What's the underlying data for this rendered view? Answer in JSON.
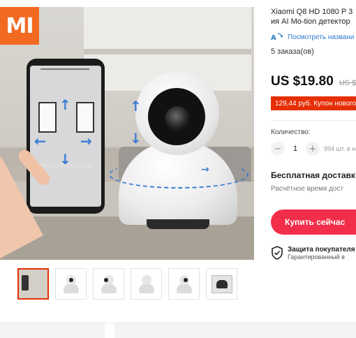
{
  "brand": {
    "logo_text": "MI",
    "logo_color": "#f26a21"
  },
  "product": {
    "title_line1": "Xiaomi Q8 HD 1080 P 3",
    "title_line2": "ия AI Mo-tion детектор",
    "translate_label": "Посмотреть названи",
    "translate_icon": "translate-icon",
    "orders": "5 заказа(ов)",
    "price": "US $19.80",
    "old_price": "US $",
    "coupon": "129,44 руб. Купон нового",
    "quantity_label": "Количество:",
    "quantity_value": "1",
    "stock": "994 шт. в нал",
    "shipping_title": "Бесплатная доставк",
    "shipping_sub": "Расчётное время дост",
    "buy_label": "Купить сейчас",
    "protection_title": "Защита покупателя",
    "protection_sub": "Гарантированный в"
  },
  "colors": {
    "accent": "#e62e04",
    "buy_button": "#f22e4a",
    "link": "#2e7bc8",
    "coupon_bg": "#ffe3e0"
  },
  "thumbnails": [
    {
      "name": "thumb-scene",
      "active": true
    },
    {
      "name": "thumb-camera-front",
      "active": false
    },
    {
      "name": "thumb-camera-side",
      "active": false
    },
    {
      "name": "thumb-camera-back",
      "active": false
    },
    {
      "name": "thumb-camera-angle",
      "active": false
    },
    {
      "name": "thumb-package",
      "active": false
    }
  ]
}
